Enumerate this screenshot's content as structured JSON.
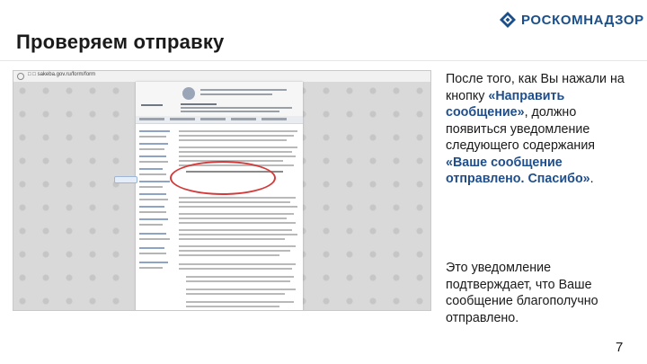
{
  "header": {
    "title": "Проверяем отправку",
    "logo_text": "РОСКОМНАДЗОР"
  },
  "screenshot": {
    "url": "□ □ sakeba.gov.ru/form/form"
  },
  "description": {
    "part1": "После того, как Вы нажали на кнопку ",
    "button_name": "«Направить сообщение»",
    "part2": ", должно появиться уведомление следующего содержания ",
    "notification": "«Ваше сообщение отправлено. Спасибо»",
    "part3": "."
  },
  "confirmation": "Это уведомление подтверждает, что Ваше сообщение благополучно отправлено.",
  "page_number": "7",
  "colors": {
    "accent": "#1f4e8c",
    "highlight_oval": "#d43a3a"
  }
}
